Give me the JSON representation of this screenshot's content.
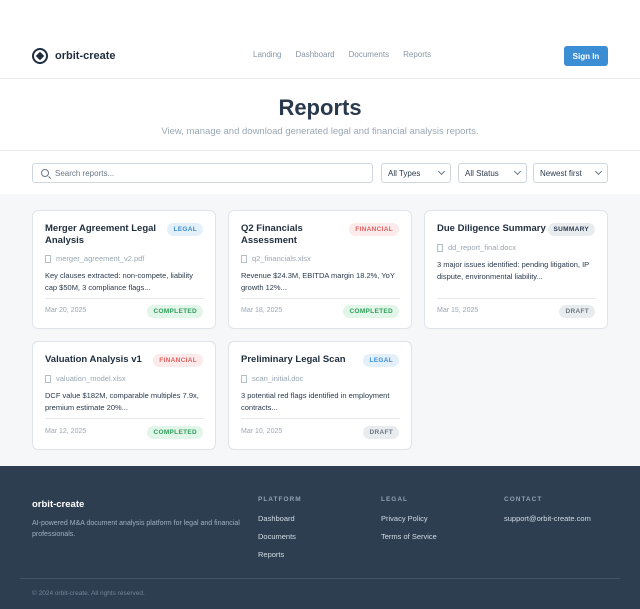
{
  "brand": {
    "name": "orbit-create"
  },
  "nav": {
    "links": [
      "Landing",
      "Dashboard",
      "Documents",
      "Reports"
    ],
    "signin_label": "Sign In"
  },
  "hero": {
    "title": "Reports",
    "subtitle": "View, manage and download generated legal and financial analysis reports."
  },
  "filters": {
    "search_placeholder": "Search reports...",
    "type_value": "All Types",
    "status_value": "All Status",
    "sort_value": "Newest first"
  },
  "reports": [
    {
      "title": "Merger Agreement Legal Analysis",
      "badge": "LEGAL",
      "file": "merger_agreement_v2.pdf",
      "desc": "Key clauses extracted: non-compete, liability cap $50M, 3 compliance flags...",
      "date": "Mar 20, 2025",
      "status": "COMPLETED"
    },
    {
      "title": "Q2 Financials Assessment",
      "badge": "FINANCIAL",
      "file": "q2_financials.xlsx",
      "desc": "Revenue $24.3M, EBITDA margin 18.2%, YoY growth 12%...",
      "date": "Mar 18, 2025",
      "status": "COMPLETED"
    },
    {
      "title": "Due Diligence Summary",
      "badge": "SUMMARY",
      "file": "dd_report_final.docx",
      "desc": "3 major issues identified: pending litigation, IP dispute, environmental liability...",
      "date": "Mar 15, 2025",
      "status": "DRAFT"
    },
    {
      "title": "Valuation Analysis v1",
      "badge": "FINANCIAL",
      "file": "valuation_model.xlsx",
      "desc": "DCF value $182M, comparable multiples 7.9x, premium estimate 20%...",
      "date": "Mar 12, 2025",
      "status": "COMPLETED"
    },
    {
      "title": "Preliminary Legal Scan",
      "badge": "LEGAL",
      "file": "scan_initial.doc",
      "desc": "3 potential red flags identified in employment contracts...",
      "date": "Mar 10, 2025",
      "status": "DRAFT"
    }
  ],
  "footer": {
    "brand": "orbit-create",
    "description": "AI-powered M&A document analysis platform for legal and financial professionals.",
    "platform": {
      "heading": "PLATFORM",
      "links": [
        "Dashboard",
        "Documents",
        "Reports"
      ]
    },
    "legal": {
      "heading": "LEGAL",
      "links": [
        "Privacy Policy",
        "Terms of Service"
      ]
    },
    "contact": {
      "heading": "CONTACT",
      "email": "support@orbit-create.com"
    },
    "copyright": "© 2024 orbit-create. All rights reserved."
  }
}
